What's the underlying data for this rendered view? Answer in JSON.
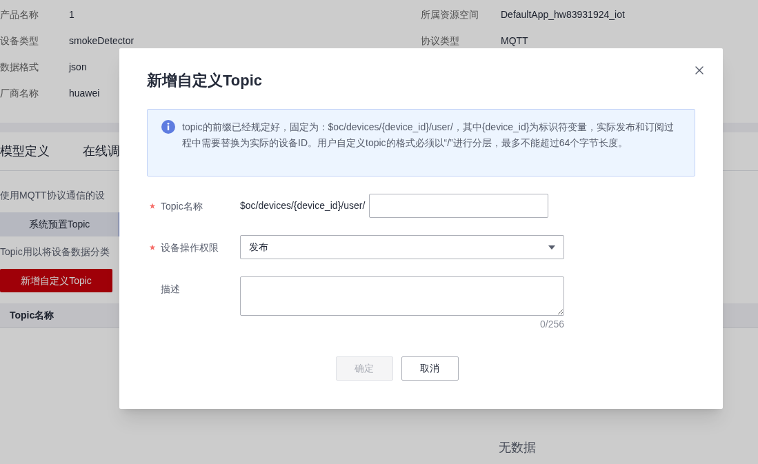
{
  "product_info": {
    "left": [
      {
        "label": "产品名称",
        "value": "1"
      },
      {
        "label": "设备类型",
        "value": "smokeDetector"
      },
      {
        "label": "数据格式",
        "value": "json"
      },
      {
        "label": "厂商名称",
        "value": "huawei"
      }
    ],
    "right": [
      {
        "label": "所属资源空间",
        "value": "DefaultApp_hw83931924_iot"
      },
      {
        "label": "协议类型",
        "value": "MQTT"
      }
    ]
  },
  "tabs": [
    "模型定义",
    "在线调"
  ],
  "description": "使用MQTT协议通信的设",
  "topic_tab": "系统预置Topic",
  "hint": "Topic用以将设备数据分类",
  "add_button": "新增自定义Topic",
  "table": {
    "columns": [
      "Topic名称"
    ],
    "empty_text": "无数据"
  },
  "dialog": {
    "title": "新增自定义Topic",
    "alert": "topic的前缀已经规定好，固定为：$oc/devices/{device_id}/user/，其中{device_id}为标识符变量，实际发布和订阅过程中需要替换为实际的设备ID。用户自定义topic的格式必须以“/”进行分层，最多不能超过64个字节长度。",
    "fields": [
      {
        "kind": "prefixed_input",
        "label": "Topic名称",
        "required": true,
        "prefix": "$oc/devices/{device_id}/user/"
      },
      {
        "kind": "select",
        "label": "设备操作权限",
        "required": true,
        "value": "发布"
      },
      {
        "kind": "textarea",
        "label": "描述",
        "required": false,
        "counter": "0/256"
      }
    ],
    "buttons": [
      {
        "label": "确定",
        "disabled": true
      },
      {
        "label": "取消",
        "disabled": false
      }
    ]
  }
}
